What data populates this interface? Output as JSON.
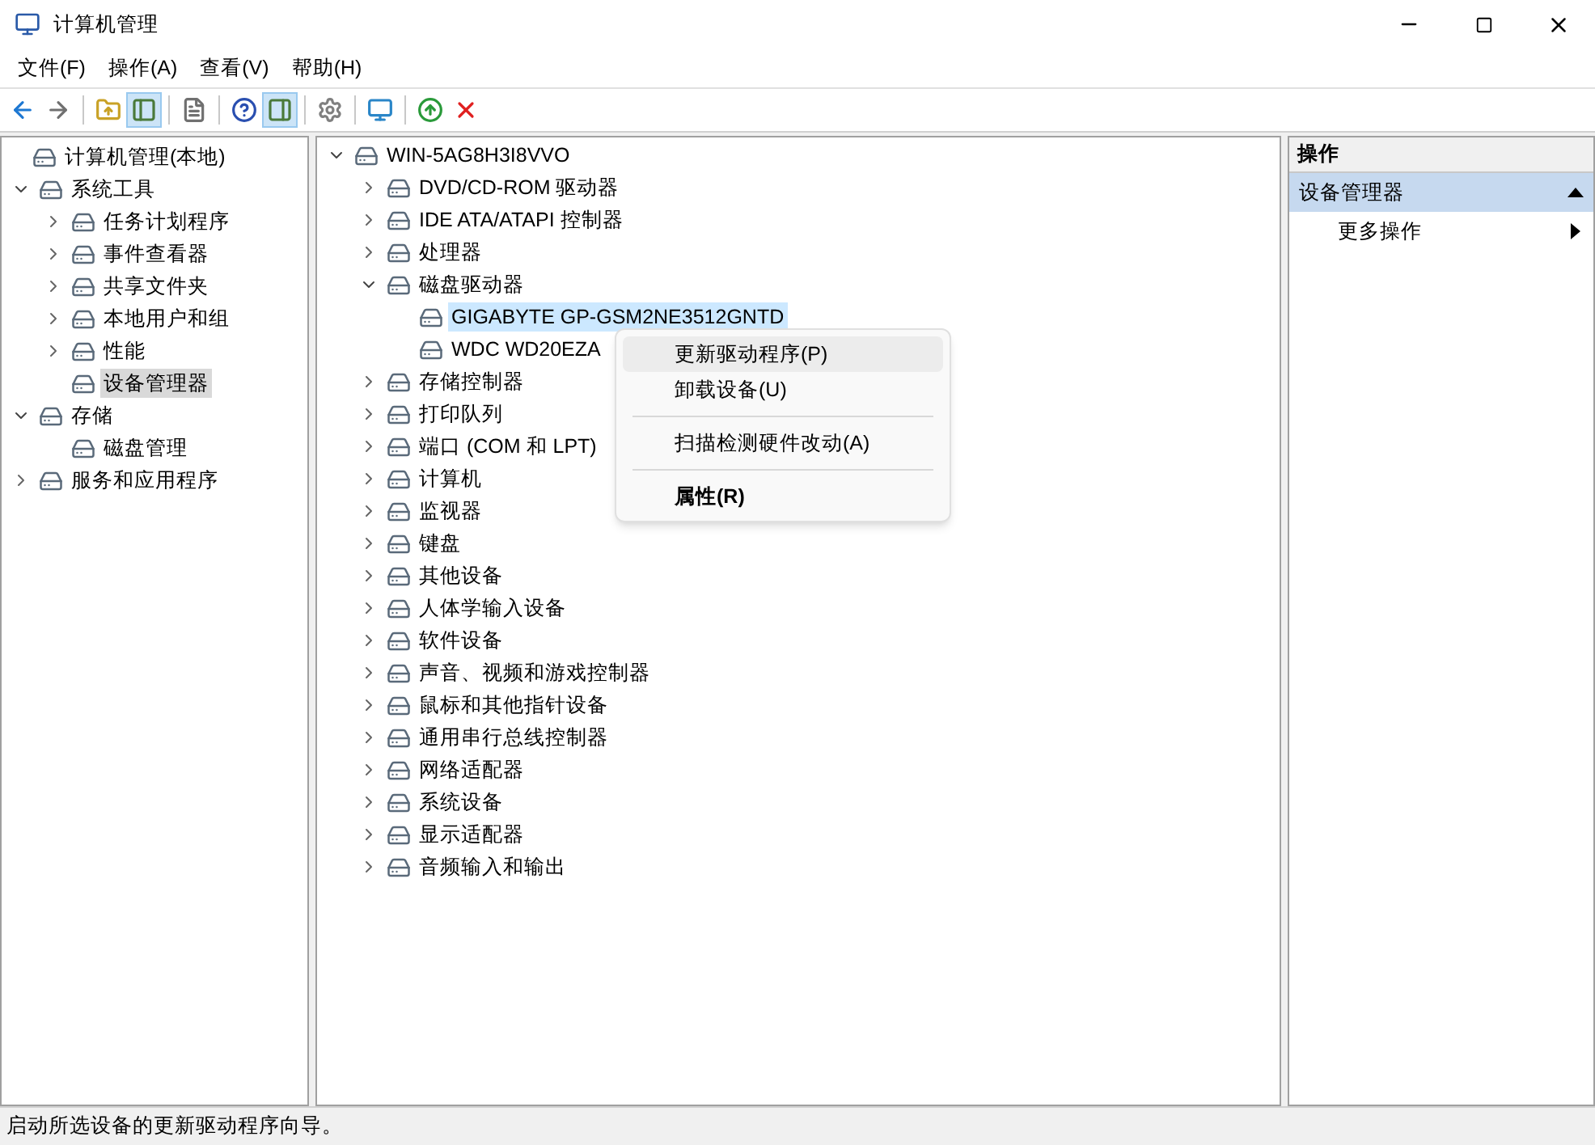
{
  "window": {
    "title": "计算机管理"
  },
  "menu": [
    "文件(F)",
    "操作(A)",
    "查看(V)",
    "帮助(H)"
  ],
  "toolbar": [
    {
      "kind": "button",
      "pressed": false
    },
    {
      "kind": "button",
      "pressed": false
    },
    {
      "kind": "separator"
    },
    {
      "kind": "button",
      "pressed": false
    },
    {
      "kind": "button",
      "pressed": true
    },
    {
      "kind": "separator"
    },
    {
      "kind": "button",
      "pressed": false
    },
    {
      "kind": "separator"
    },
    {
      "kind": "button",
      "pressed": false
    },
    {
      "kind": "button",
      "pressed": true
    },
    {
      "kind": "separator"
    },
    {
      "kind": "button",
      "pressed": false
    },
    {
      "kind": "separator"
    },
    {
      "kind": "button",
      "pressed": false
    },
    {
      "kind": "separator"
    },
    {
      "kind": "button",
      "pressed": false
    },
    {
      "kind": "button",
      "pressed": false
    }
  ],
  "console_tree": [
    {
      "label": "计算机管理(本地)",
      "kind": "leaf",
      "selected": false,
      "children": [
        {
          "label": "系统工具",
          "kind": "branch",
          "expanded": true,
          "selected": false,
          "children": [
            {
              "label": "任务计划程序",
              "kind": "branch",
              "expanded": false,
              "selected": false
            },
            {
              "label": "事件查看器",
              "kind": "branch",
              "expanded": false,
              "selected": false
            },
            {
              "label": "共享文件夹",
              "kind": "branch",
              "expanded": false,
              "selected": false
            },
            {
              "label": "本地用户和组",
              "kind": "branch",
              "expanded": false,
              "selected": false
            },
            {
              "label": "性能",
              "kind": "branch",
              "expanded": false,
              "selected": false
            },
            {
              "label": "设备管理器",
              "kind": "leaf",
              "selected": true
            }
          ]
        },
        {
          "label": "存储",
          "kind": "branch",
          "expanded": true,
          "selected": false,
          "children": [
            {
              "label": "磁盘管理",
              "kind": "leaf",
              "selected": false
            }
          ]
        },
        {
          "label": "服务和应用程序",
          "kind": "branch",
          "expanded": false,
          "selected": false
        }
      ]
    }
  ],
  "device_tree": [
    {
      "label": "WIN-5AG8H3I8VVO",
      "kind": "branch",
      "expanded": true,
      "selected": false,
      "children": [
        {
          "label": "DVD/CD-ROM 驱动器",
          "kind": "branch",
          "expanded": false,
          "selected": false
        },
        {
          "label": "IDE ATA/ATAPI 控制器",
          "kind": "branch",
          "expanded": false,
          "selected": false
        },
        {
          "label": "处理器",
          "kind": "branch",
          "expanded": false,
          "selected": false
        },
        {
          "label": "磁盘驱动器",
          "kind": "branch",
          "expanded": true,
          "selected": false,
          "children": [
            {
              "label": "GIGABYTE GP-GSM2NE3512GNTD",
              "kind": "leaf",
              "selected": true
            },
            {
              "label": "WDC WD20EZA",
              "kind": "leaf",
              "selected": false
            }
          ]
        },
        {
          "label": "存储控制器",
          "kind": "branch",
          "expanded": false,
          "selected": false
        },
        {
          "label": "打印队列",
          "kind": "branch",
          "expanded": false,
          "selected": false
        },
        {
          "label": "端口 (COM 和 LPT)",
          "kind": "branch",
          "expanded": false,
          "selected": false
        },
        {
          "label": "计算机",
          "kind": "branch",
          "expanded": false,
          "selected": false
        },
        {
          "label": "监视器",
          "kind": "branch",
          "expanded": false,
          "selected": false
        },
        {
          "label": "键盘",
          "kind": "branch",
          "expanded": false,
          "selected": false
        },
        {
          "label": "其他设备",
          "kind": "branch",
          "expanded": false,
          "selected": false
        },
        {
          "label": "人体学输入设备",
          "kind": "branch",
          "expanded": false,
          "selected": false
        },
        {
          "label": "软件设备",
          "kind": "branch",
          "expanded": false,
          "selected": false
        },
        {
          "label": "声音、视频和游戏控制器",
          "kind": "branch",
          "expanded": false,
          "selected": false
        },
        {
          "label": "鼠标和其他指针设备",
          "kind": "branch",
          "expanded": false,
          "selected": false
        },
        {
          "label": "通用串行总线控制器",
          "kind": "branch",
          "expanded": false,
          "selected": false
        },
        {
          "label": "网络适配器",
          "kind": "branch",
          "expanded": false,
          "selected": false
        },
        {
          "label": "系统设备",
          "kind": "branch",
          "expanded": false,
          "selected": false
        },
        {
          "label": "显示适配器",
          "kind": "branch",
          "expanded": false,
          "selected": false
        },
        {
          "label": "音频输入和输出",
          "kind": "branch",
          "expanded": false,
          "selected": false
        }
      ]
    }
  ],
  "context_menu": [
    {
      "kind": "item",
      "label": "更新驱动程序(P)",
      "selected": true,
      "default": false
    },
    {
      "kind": "item",
      "label": "卸载设备(U)",
      "selected": false,
      "default": false
    },
    {
      "kind": "separator"
    },
    {
      "kind": "item",
      "label": "扫描检测硬件改动(A)",
      "selected": false,
      "default": false
    },
    {
      "kind": "separator"
    },
    {
      "kind": "item",
      "label": "属性(R)",
      "selected": false,
      "default": true
    }
  ],
  "actions_pane": {
    "header": "操作",
    "section": {
      "label": "设备管理器",
      "expanded": true
    },
    "items": [
      {
        "label": "更多操作"
      }
    ]
  },
  "status_bar": "启动所选设备的更新驱动程序向导。"
}
